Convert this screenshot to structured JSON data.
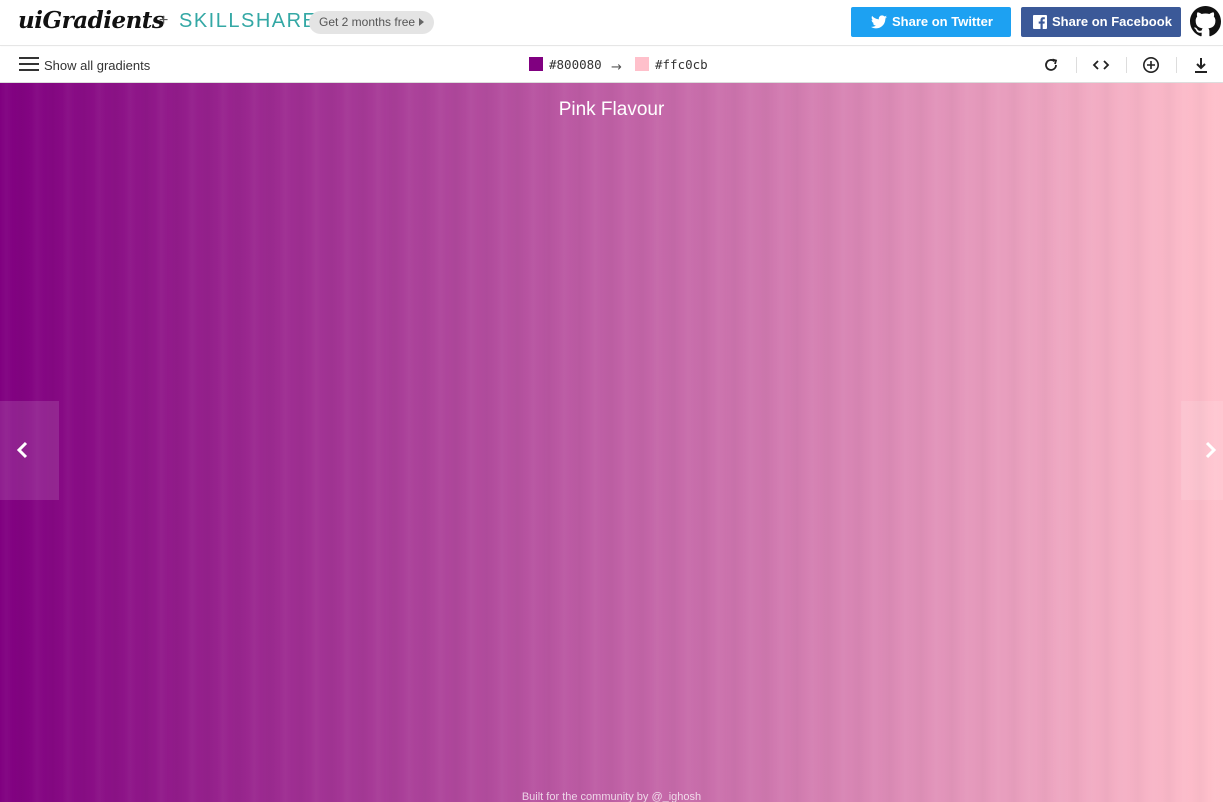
{
  "header": {
    "logo": "uiGradients",
    "plus": "+",
    "partner": "SKILLSHARE",
    "promo_label": "Get 2 months free",
    "twitter_label": "Share on Twitter",
    "facebook_label": "Share on Facebook",
    "github_icon": "github-icon"
  },
  "toolbar": {
    "show_all_label": "Show all gradients",
    "color_from": "#800080",
    "color_to": "#ffc0cb",
    "arrow": "→",
    "tools": [
      "rotate-icon",
      "code-icon",
      "add-icon",
      "download-icon"
    ]
  },
  "gradient": {
    "name": "Pink Flavour",
    "start_color": "#800080",
    "end_color": "#ffc0cb",
    "direction": "to right"
  },
  "footer": {
    "text": "Built for the community by @_ighosh"
  },
  "colors": {
    "twitter": "#1da1f2",
    "facebook": "#3b5998",
    "skillshare": "#34a8a5"
  }
}
